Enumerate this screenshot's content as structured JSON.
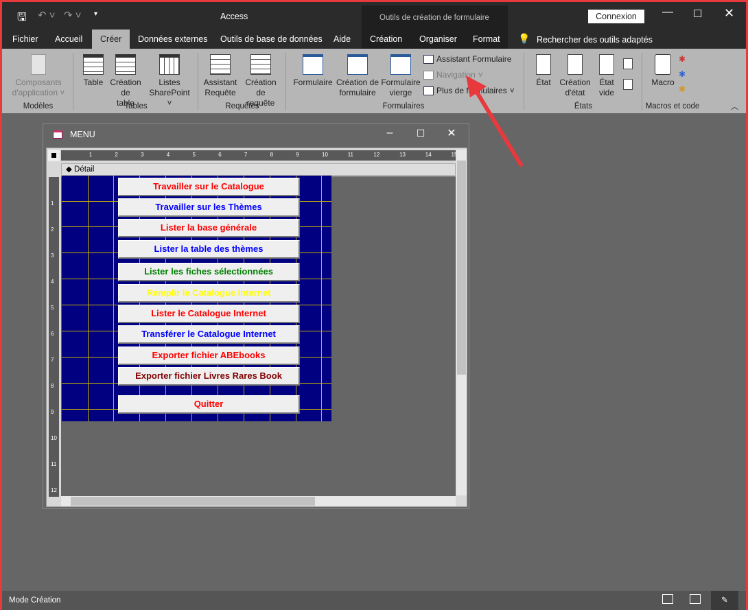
{
  "app": {
    "title": "Access",
    "contextual_title": "Outils de création de formulaire",
    "signin": "Connexion",
    "search": "Rechercher des outils adaptés"
  },
  "tabs": [
    "Fichier",
    "Accueil",
    "Créer",
    "Données externes",
    "Outils de base de données",
    "Aide",
    "Création",
    "Organiser",
    "Format"
  ],
  "active_tab": "Créer",
  "ribbon": {
    "modeles": {
      "label": "Modèles",
      "items": [
        "Composants d'application"
      ]
    },
    "tables": {
      "label": "Tables",
      "items": [
        "Table",
        "Création de table",
        "Listes SharePoint"
      ]
    },
    "requetes": {
      "label": "Requêtes",
      "items": [
        "Assistant Requête",
        "Création de requête"
      ]
    },
    "formulaires": {
      "label": "Formulaires",
      "items": [
        "Formulaire",
        "Création de formulaire",
        "Formulaire vierge"
      ],
      "small": [
        "Assistant Formulaire",
        "Navigation",
        "Plus de formulaires"
      ]
    },
    "etats": {
      "label": "États",
      "items": [
        "État",
        "Création d'état",
        "État vide"
      ]
    },
    "macros": {
      "label": "Macros et code",
      "items": [
        "Macro"
      ]
    }
  },
  "form_window": {
    "title": "MENU",
    "section": "Détail",
    "ruler_h": [
      "1",
      "2",
      "3",
      "4",
      "5",
      "6",
      "7",
      "8",
      "9",
      "10",
      "11",
      "12",
      "13",
      "14",
      "15"
    ],
    "ruler_v": [
      "1",
      "2",
      "3",
      "4",
      "5",
      "6",
      "7",
      "8",
      "9",
      "10",
      "11",
      "12"
    ]
  },
  "buttons": [
    {
      "label": "Travailler sur le Catalogue",
      "color": "#ff0000"
    },
    {
      "label": "Travailler sur les Thèmes",
      "color": "#0000ff"
    },
    {
      "label": "Lister la base générale",
      "color": "#ff0000"
    },
    {
      "label": "Lister la table des thèmes",
      "color": "#0000ff"
    },
    {
      "label": "Lister les fiches sélectionnées",
      "color": "#008000"
    },
    {
      "label": "Remplir le Catalogue Internet",
      "color": "#ffff00"
    },
    {
      "label": "Lister le Catalogue Internet",
      "color": "#ff0000"
    },
    {
      "label": "Transférer le Catalogue Internet",
      "color": "#0000ff"
    },
    {
      "label": "Exporter fichier ABEbooks",
      "color": "#ff0000"
    },
    {
      "label": "Exporter fichier Livres Rares Book",
      "color": "#800000"
    },
    {
      "label": "Quitter",
      "color": "#ff0000"
    }
  ],
  "status": {
    "mode": "Mode Création"
  },
  "colors": {
    "annotation_arrow": "#e8393d",
    "form_bg": "#000080",
    "grid": "#c8b400"
  }
}
